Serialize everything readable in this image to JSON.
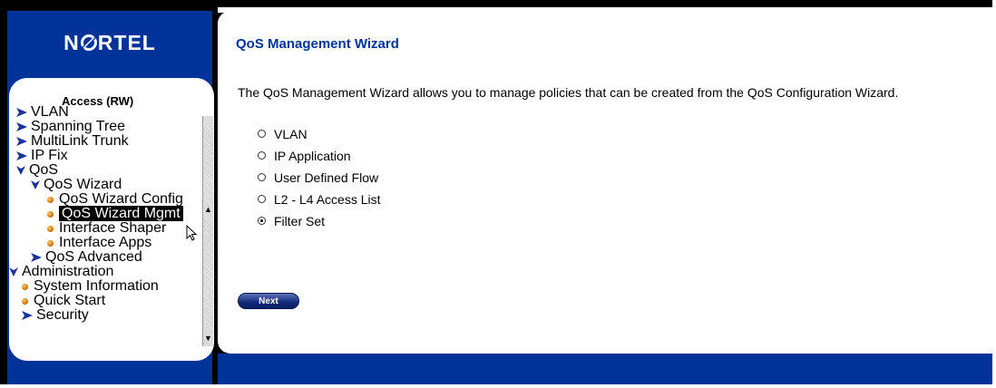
{
  "brand": {
    "logo_text_left": "N",
    "logo_text_right": "RTEL",
    "logo_full": "NORTEL"
  },
  "nav": {
    "title": "Access (RW)",
    "items": [
      {
        "label": "VLAN",
        "icon": "chevron-right-icon"
      },
      {
        "label": "Spanning Tree",
        "icon": "chevron-right-icon"
      },
      {
        "label": "MultiLink Trunk",
        "icon": "chevron-right-icon"
      },
      {
        "label": "IP Fix",
        "icon": "chevron-right-icon"
      },
      {
        "label": "QoS",
        "icon": "chevron-down-icon"
      },
      {
        "label": "QoS Wizard",
        "icon": "chevron-down-icon"
      },
      {
        "label": "QoS Wizard Config",
        "icon": "bullet-icon"
      },
      {
        "label": "QoS Wizard Mgmt",
        "icon": "bullet-icon",
        "selected": true
      },
      {
        "label": "Interface Shaper",
        "icon": "bullet-icon"
      },
      {
        "label": "Interface Apps",
        "icon": "bullet-icon"
      },
      {
        "label": "QoS Advanced",
        "icon": "chevron-right-icon"
      },
      {
        "label": "Administration",
        "icon": "chevron-down-icon"
      },
      {
        "label": "System Information",
        "icon": "bullet-icon"
      },
      {
        "label": "Quick Start",
        "icon": "bullet-icon"
      },
      {
        "label": "Security",
        "icon": "chevron-right-icon"
      }
    ]
  },
  "main": {
    "title": "QoS Management Wizard",
    "description": "The QoS Management Wizard allows you to manage policies that can be created from the QoS Configuration Wizard.",
    "options": [
      {
        "label": "VLAN",
        "checked": false
      },
      {
        "label": "IP Application",
        "checked": false
      },
      {
        "label": "User Defined Flow",
        "checked": false
      },
      {
        "label": "L2 - L4 Access List",
        "checked": false
      },
      {
        "label": "Filter Set",
        "checked": true
      }
    ],
    "next_label": "Next"
  },
  "colors": {
    "brand_blue": "#003399",
    "title_blue": "#003399",
    "bullet_orange": "#cc6600"
  }
}
